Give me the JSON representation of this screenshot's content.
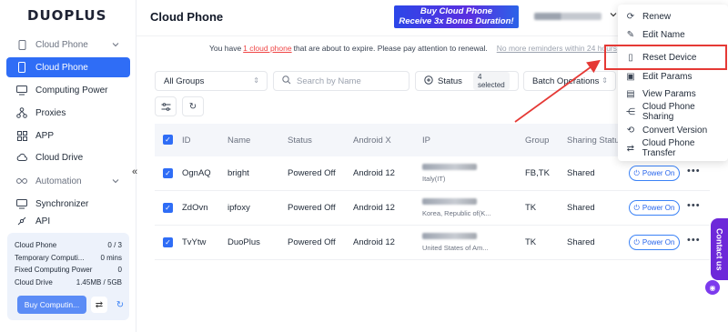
{
  "brand": {
    "logo": "DUOPLUS"
  },
  "sidebar": {
    "groups": [
      {
        "label": "Cloud Phone"
      },
      {
        "label": "Automation"
      }
    ],
    "items": [
      {
        "label": "Cloud Phone"
      },
      {
        "label": "Computing Power"
      },
      {
        "label": "Proxies"
      },
      {
        "label": "APP"
      },
      {
        "label": "Cloud Drive"
      },
      {
        "label": "Synchronizer"
      },
      {
        "label": "API"
      }
    ],
    "collapse": "«"
  },
  "usage": {
    "rows": [
      {
        "label": "Cloud Phone",
        "value": "0 / 3"
      },
      {
        "label": "Temporary Computi...",
        "value": "0 mins"
      },
      {
        "label": "Fixed Computing Power",
        "value": "0"
      },
      {
        "label": "Cloud Drive",
        "value": "1.45MB / 5GB"
      }
    ],
    "buy_label": "Buy Computin..."
  },
  "header": {
    "title": "Cloud Phone",
    "promo_line1": "Buy Cloud Phone",
    "promo_line2": "Receive 3x Bonus Duration!"
  },
  "notice": {
    "prefix": "You have",
    "link": "1 cloud phone",
    "suffix": "that are about to expire. Please pay attention to renewal.",
    "dismiss": "No more reminders within 24 hours"
  },
  "filters": {
    "group_select": "All Groups",
    "search_placeholder": "Search by Name",
    "status_label": "Status",
    "status_count": "4 selected",
    "batch_label": "Batch Operations"
  },
  "table": {
    "headers": [
      "ID",
      "Name",
      "Status",
      "Android X",
      "IP",
      "Group",
      "Sharing Status"
    ],
    "rows": [
      {
        "id": "OgnAQ",
        "name": "bright",
        "status": "Powered Off",
        "android": "Android 12",
        "ip_loc": "Italy(IT)",
        "group": "FB,TK",
        "sharing": "Shared",
        "power": "Power On"
      },
      {
        "id": "ZdOvn",
        "name": "ipfoxy",
        "status": "Powered Off",
        "android": "Android 12",
        "ip_loc": "Korea, Republic of(K...",
        "group": "TK",
        "sharing": "Shared",
        "power": "Power On"
      },
      {
        "id": "TvYtw",
        "name": "DuoPlus",
        "status": "Powered Off",
        "android": "Android 12",
        "ip_loc": "United States of Am...",
        "group": "TK",
        "sharing": "Shared",
        "power": "Power On"
      }
    ]
  },
  "menu": {
    "items": [
      "Renew",
      "Edit Name",
      "Reset Device",
      "Edit Params",
      "View Params",
      "Cloud Phone Sharing",
      "Convert Version",
      "Cloud Phone Transfer"
    ]
  },
  "contact": {
    "label": "Contact us"
  },
  "colors": {
    "accent": "#2f6df6",
    "highlight": "#e53935",
    "contact": "#6d28d9"
  }
}
